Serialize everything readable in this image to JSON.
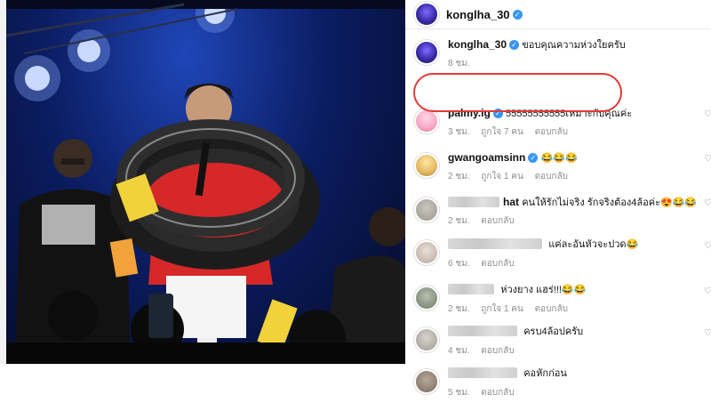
{
  "post": {
    "author": "konglha_30",
    "caption": "ขอบคุณความห่วงใยครับ",
    "caption_time": "8 ชม."
  },
  "comments": [
    {
      "user": "palmy.ig",
      "verified": true,
      "text": "55555555555เหมาะกับคุณค่ะ",
      "time": "3 ชม.",
      "likes": "ถูกใจ 7 คน",
      "reply": "ตอบกลับ"
    },
    {
      "user": "gwangoamsinn",
      "verified": true,
      "text": "😂😂😂",
      "time": "2 ชม.",
      "likes": "ถูกใจ 1 คน",
      "reply": "ตอบกลับ"
    },
    {
      "user": "hat",
      "verified": false,
      "text": "คนให้รักไม่จริง รักจริงต้อง4ล้อค่ะ😍😂😂",
      "time": "2 ชม.",
      "likes": "",
      "reply": "ตอบกลับ"
    },
    {
      "user": "",
      "verified": false,
      "text": "แค่ละอันหัวจะปวด😂",
      "time": "6 ชม.",
      "likes": "",
      "reply": "ตอบกลับ"
    },
    {
      "user": "",
      "verified": false,
      "text": "ห่วงยาง แฮร่!!!😂😂",
      "time": "2 ชม.",
      "likes": "ถูกใจ 1 คน",
      "reply": "ตอบกลับ"
    },
    {
      "user": "",
      "verified": false,
      "text": "ครบ4ล้อปครับ",
      "time": "4 ชม.",
      "likes": "",
      "reply": "ตอบกลับ"
    },
    {
      "user": "",
      "verified": false,
      "text": "คอหักก่อน",
      "time": "5 ชม.",
      "likes": "",
      "reply": "ตอบกลับ"
    }
  ],
  "colors": {
    "highlight": "#e53935",
    "verified": "#3897f0"
  },
  "icons": {
    "verified": "verified-badge-icon",
    "like": "heart-icon"
  }
}
